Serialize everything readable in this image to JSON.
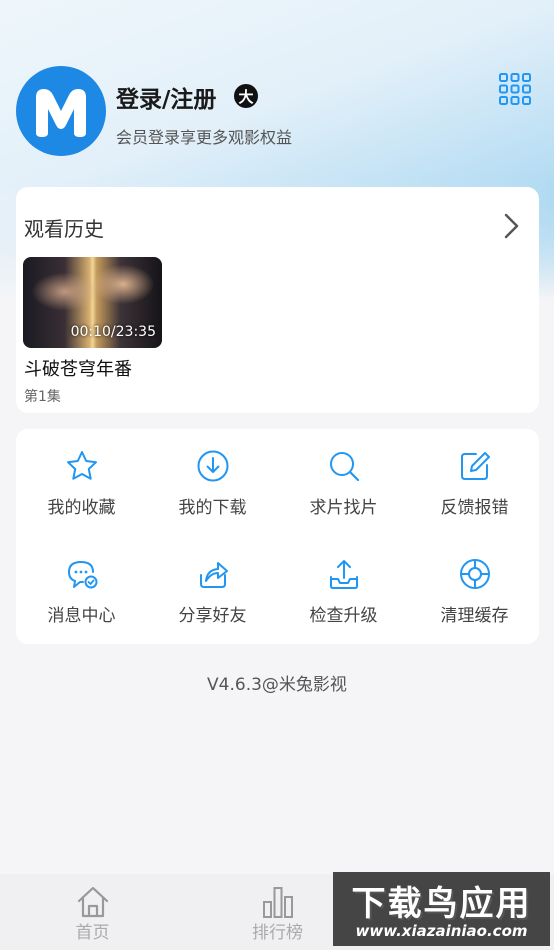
{
  "header": {
    "login_title": "登录/注册",
    "vip_badge": "大",
    "login_subtitle": "会员登录享更多观影权益"
  },
  "history": {
    "title": "观看历史",
    "items": [
      {
        "title": "斗破苍穹年番",
        "episode": "第1集",
        "progress_time": "00:10/23:35"
      }
    ]
  },
  "actions": [
    {
      "label": "我的收藏",
      "icon": "star-icon"
    },
    {
      "label": "我的下载",
      "icon": "download-icon"
    },
    {
      "label": "求片找片",
      "icon": "search-icon"
    },
    {
      "label": "反馈报错",
      "icon": "edit-icon"
    },
    {
      "label": "消息中心",
      "icon": "message-icon"
    },
    {
      "label": "分享好友",
      "icon": "share-icon"
    },
    {
      "label": "检查升级",
      "icon": "upload-icon"
    },
    {
      "label": "清理缓存",
      "icon": "clean-icon"
    }
  ],
  "version": "V4.6.3@米兔影视",
  "tabbar": {
    "items": [
      {
        "label": "首页",
        "icon": "home-icon"
      },
      {
        "label": "排行榜",
        "icon": "chart-icon"
      }
    ]
  },
  "watermark": {
    "big": "下载鸟应用",
    "small": "www.xiazainiao.com"
  },
  "colors": {
    "accent": "#2196f3",
    "avatar": "#1e88e5"
  }
}
